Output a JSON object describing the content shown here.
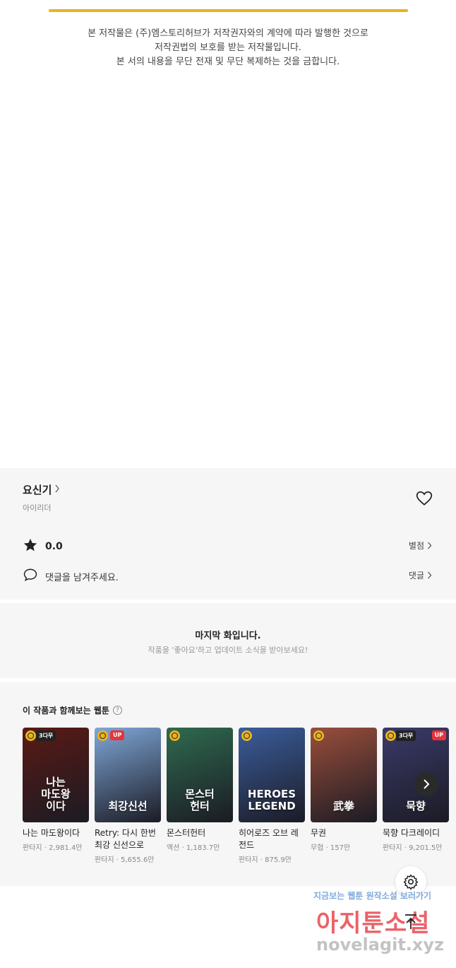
{
  "notice": {
    "line1": "본 저작물은 (주)엠스토리허브가 저작권자와의 계약에 따라 발행한 것으로",
    "line2": "저작권법의 보호를 받는 저작물입니다.",
    "line3": "본 서의 내용을 무단 전재 및 무단 복제하는 것을 금합니다."
  },
  "work": {
    "title": "요신기",
    "author": "아이리더",
    "rating": "0.0",
    "rate_label": "별점",
    "comment_placeholder": "댓글을 남겨주세요.",
    "comment_label": "댓글"
  },
  "last_episode": {
    "title": "마지막 화입니다.",
    "subtitle": "작품을 '좋아요'하고 업데이트 소식을 받아보세요!"
  },
  "recommend": {
    "title": "이 작품과 함께보는 웹툰",
    "items": [
      {
        "name": "나는 마도왕이다",
        "meta": "판타지 · 2,981.4만",
        "badge": "3다무",
        "up": false,
        "art": "나는\n마도왕\n이다",
        "color": "#5a1a14"
      },
      {
        "name": "Retry: 다시 한번 최강 신선으로",
        "meta": "판타지 · 5,655.6만",
        "badge": "",
        "up": true,
        "art": "최강신선",
        "color": "#7fa7d8"
      },
      {
        "name": "몬스터헌터",
        "meta": "액션 · 1,183.7만",
        "badge": "",
        "up": false,
        "art": "몬스터\n헌터",
        "color": "#2f6a4f"
      },
      {
        "name": "히어로즈 오브 레전드",
        "meta": "판타지 · 875.9만",
        "badge": "",
        "up": false,
        "art": "HEROES\nLEGEND",
        "color": "#3b5d9c"
      },
      {
        "name": "무권",
        "meta": "무협 · 157만",
        "badge": "",
        "up": false,
        "art": "武拳",
        "color": "#9a4e3b"
      },
      {
        "name": "묵향 다크레이디",
        "meta": "판타지 · 9,201.5만",
        "badge": "3다무",
        "up": true,
        "art": "묵향",
        "color": "#3a3a6a"
      }
    ]
  },
  "watermark": {
    "tagline": "지금보는 웹툰 원작소설 보러가기",
    "logo": "아지툰소설",
    "domain": "novelagit.xyz"
  }
}
